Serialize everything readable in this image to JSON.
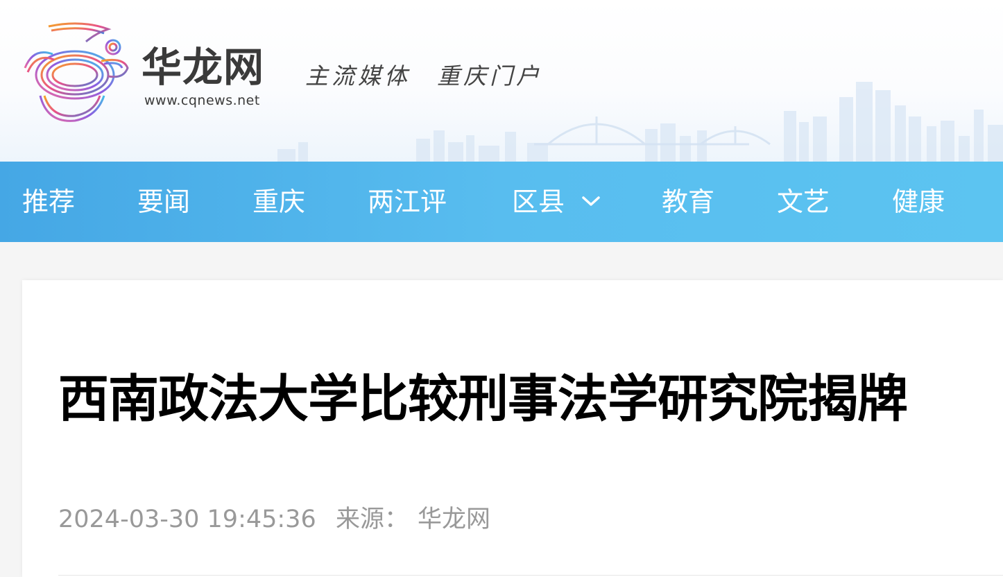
{
  "header": {
    "brand_name": "华龙网",
    "brand_url": "www.cqnews.net",
    "slogan": "主流媒体　重庆门户"
  },
  "nav": {
    "items": [
      {
        "label": "推荐"
      },
      {
        "label": "要闻"
      },
      {
        "label": "重庆"
      },
      {
        "label": "两江评"
      },
      {
        "label": "区县",
        "has_dropdown": true
      },
      {
        "label": "教育"
      },
      {
        "label": "文艺"
      },
      {
        "label": "健康"
      }
    ]
  },
  "article": {
    "title": "西南政法大学比较刑事法学研究院揭牌",
    "datetime": "2024-03-30 19:45:36",
    "source_label": "来源：",
    "source_value": "华龙网"
  },
  "colors": {
    "nav_start": "#45a7e5",
    "nav_end": "#5cc4f1",
    "title_text": "#000000",
    "meta_text": "#999999"
  }
}
